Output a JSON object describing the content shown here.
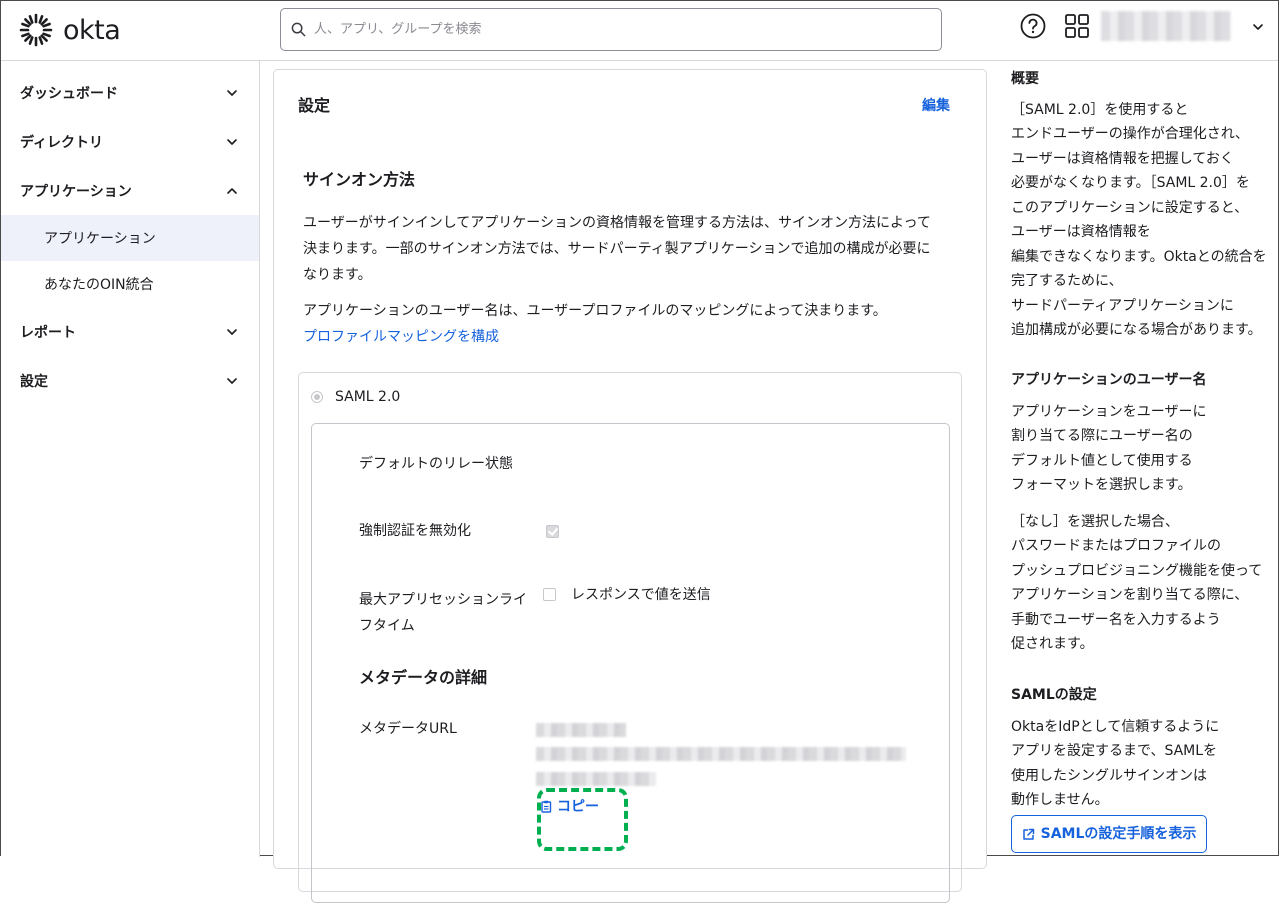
{
  "header": {
    "logo_text": "okta",
    "search_placeholder": "人、アプリ、グループを検索"
  },
  "sidebar": {
    "items": [
      {
        "label": "ダッシュボード"
      },
      {
        "label": "ディレクトリ"
      },
      {
        "label": "アプリケーション"
      },
      {
        "label": "アプリケーション"
      },
      {
        "label": "あなたのOIN統合"
      },
      {
        "label": "レポート"
      },
      {
        "label": "設定"
      }
    ]
  },
  "main": {
    "card_title": "設定",
    "edit_label": "編集",
    "section_title": "サインオン方法",
    "desc1": "ユーザーがサインインしてアプリケーションの資格情報を管理する方法は、サインオン方法によって決まります。一部のサインオン方法では、サードパーティ製アプリケーションで追加の構成が必要になります。",
    "desc2": "アプリケーションのユーザー名は、ユーザープロファイルのマッピングによって決まります。",
    "profile_mapping_link": "プロファイルマッピングを構成",
    "saml_option": "SAML 2.0",
    "default_relay_label": "デフォルトのリレー状態",
    "force_auth_label": "強制認証を無効化",
    "max_session_label": "最大アプリセッションライフタイム",
    "send_response_label": "レスポンスで値を送信",
    "metadata_title": "メタデータの詳細",
    "metadata_url_label": "メタデータURL",
    "copy_label": "コピー"
  },
  "help": {
    "overview_title": "概要",
    "overview_text": "［SAML 2.0］を使用すると\nエンドユーザーの操作が合理化され、\nユーザーは資格情報を把握しておく\n必要がなくなります。［SAML 2.0］を\nこのアプリケーションに設定すると、\nユーザーは資格情報を\n編集できなくなります。Oktaとの統合を\n完了するために、\nサードパーティアプリケーションに\n追加構成が必要になる場合があります。",
    "username_title": "アプリケーションのユーザー名",
    "username_text1": "アプリケーションをユーザーに\n割り当てる際にユーザー名の\nデフォルト値として使用する\nフォーマットを選択します。",
    "username_text2": "［なし］を選択した場合、\nパスワードまたはプロファイルの\nプッシュプロビジョニング機能を使って\nアプリケーションを割り当てる際に、\n手動でユーザー名を入力するよう\n促されます。",
    "saml_title": "SAMLの設定",
    "saml_text": "OktaをIdPとして信頼するように\nアプリを設定するまで、SAMLを\n使用したシングルサインオンは\n動作しません。",
    "saml_button": "SAMLの設定手順を表示"
  },
  "colors": {
    "accent": "#1662dd",
    "highlight": "#00b050",
    "active_bg": "#eef0fa"
  }
}
